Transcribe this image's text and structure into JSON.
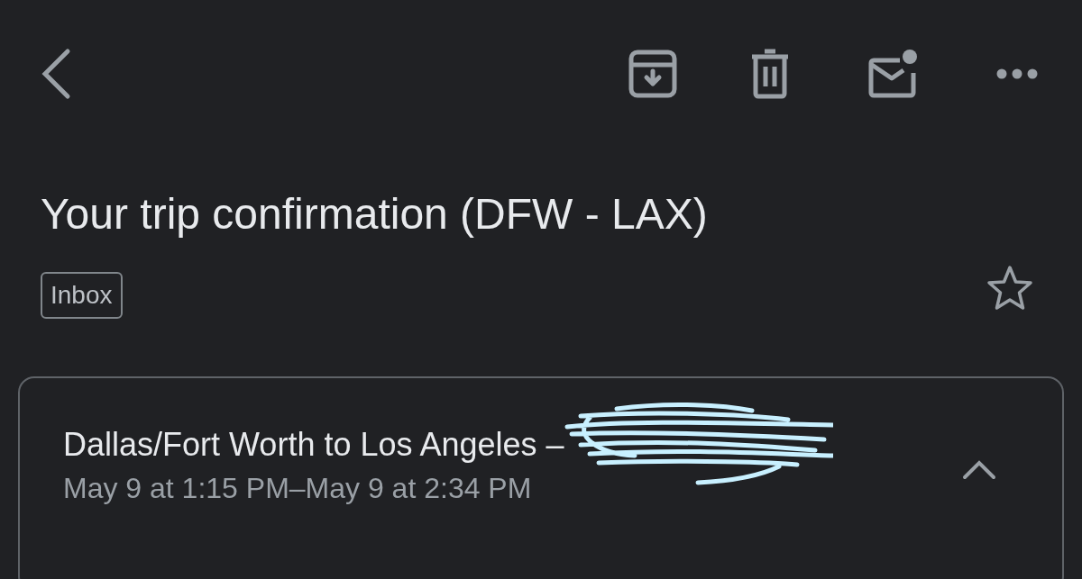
{
  "subject": "Your trip confirmation (DFW - LAX)",
  "label": "Inbox",
  "starred": false,
  "trip_card": {
    "title": "Dallas/Fort Worth to Los Angeles –",
    "times": "May 9 at 1:15 PM–May 9 at 2:34 PM",
    "expanded": true
  }
}
